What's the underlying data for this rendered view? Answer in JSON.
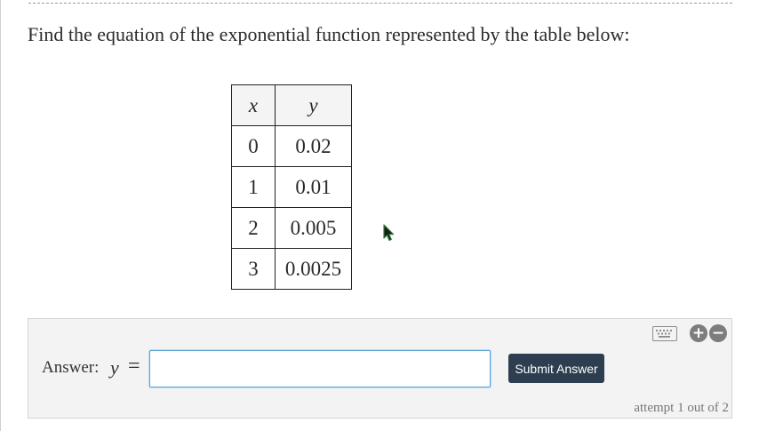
{
  "question": {
    "text": "Find the equation of the exponential function represented by the table below:"
  },
  "table": {
    "headers": [
      "x",
      "y"
    ],
    "rows": [
      [
        "0",
        "0.02"
      ],
      [
        "1",
        "0.01"
      ],
      [
        "2",
        "0.005"
      ],
      [
        "3",
        "0.0025"
      ]
    ]
  },
  "answer": {
    "label": "Answer:",
    "variable": "y",
    "equals": "=",
    "value": "",
    "submit_label": "Submit Answer",
    "attempt_text": "attempt 1 out of 2"
  },
  "tools": {
    "keyboard_icon": "keyboard-icon",
    "zoom_in_glyph": "+",
    "zoom_out_glyph": "−"
  },
  "colors": {
    "submit_bg": "#2c3e50",
    "input_border": "#5ba4d6",
    "panel_bg": "#f3f3f3",
    "cursor": "#2e7d32"
  }
}
